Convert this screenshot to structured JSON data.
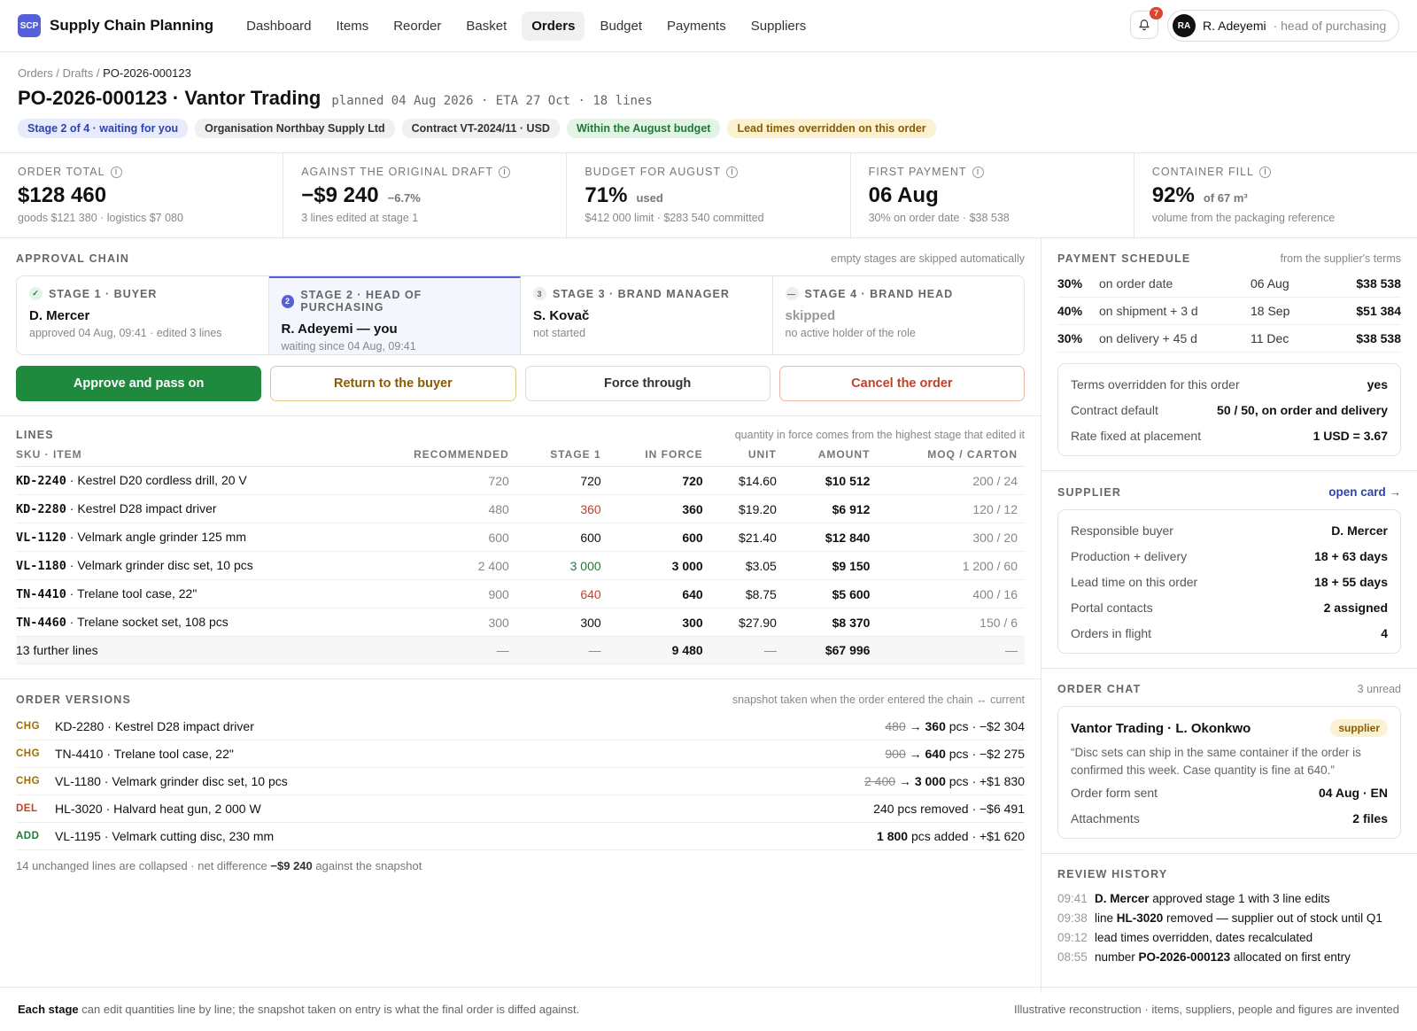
{
  "app": {
    "logo": "SCP",
    "name": "Supply Chain Planning"
  },
  "nav": [
    {
      "label": "Dashboard",
      "active": false
    },
    {
      "label": "Items",
      "active": false
    },
    {
      "label": "Reorder",
      "active": false
    },
    {
      "label": "Basket",
      "active": false
    },
    {
      "label": "Orders",
      "active": true
    },
    {
      "label": "Budget",
      "active": false
    },
    {
      "label": "Payments",
      "active": false
    },
    {
      "label": "Suppliers",
      "active": false
    }
  ],
  "notifications": {
    "icon": "bell-icon",
    "count": "7"
  },
  "user": {
    "initials": "RA",
    "name": "R. Adeyemi",
    "role": "· head of purchasing"
  },
  "breadcrumb": {
    "a": "Orders",
    "sep1": " / ",
    "b": "Drafts",
    "sep2": " / ",
    "c": "PO-2026-000123"
  },
  "order": {
    "title": "PO-2026-000123 · Vantor Trading",
    "meta": "planned 04 Aug 2026 · ETA 27 Oct · 18 lines"
  },
  "tags": [
    {
      "label": "Stage 2 of 4 · waiting for you",
      "tone": "blue"
    },
    {
      "label": "Organisation Northbay Supply Ltd",
      "tone": "grey"
    },
    {
      "label": "Contract VT-2024/11 · USD",
      "tone": "grey"
    },
    {
      "label": "Within the August budget",
      "tone": "green"
    },
    {
      "label": "Lead times overridden on this order",
      "tone": "amber"
    }
  ],
  "kpis": [
    {
      "label": "Order total",
      "value": "$128 460",
      "delta": "",
      "sub": "goods $121 380 · logistics $7 080"
    },
    {
      "label": "Against the original draft",
      "value": "−$9 240",
      "delta": "−6.7%",
      "sub": "3 lines edited at stage 1"
    },
    {
      "label": "Budget for August",
      "value": "71%",
      "delta": "used",
      "sub": "$412 000 limit · $283 540 committed"
    },
    {
      "label": "First payment",
      "value": "06 Aug",
      "delta": "",
      "sub": "30% on order date · $38 538"
    },
    {
      "label": "Container fill",
      "value": "92%",
      "delta": "of 67 m³",
      "sub": "volume from the packaging reference"
    }
  ],
  "approval": {
    "title": "Approval chain",
    "note": "empty stages are skipped automatically",
    "stages": [
      {
        "mark": "✓",
        "label": "STAGE 1 · BUYER",
        "name": "D. Mercer",
        "sub": "approved 04 Aug, 09:41 · edited 3 lines",
        "state": "done"
      },
      {
        "mark": "2",
        "label": "STAGE 2 · HEAD OF PURCHASING",
        "name": "R. Adeyemi — you",
        "sub": "waiting since 04 Aug, 09:41",
        "state": "cur"
      },
      {
        "mark": "3",
        "label": "STAGE 3 · BRAND MANAGER",
        "name": "S. Kovač",
        "sub": "not started",
        "state": "nxt"
      },
      {
        "mark": "—",
        "label": "STAGE 4 · BRAND HEAD",
        "name": "skipped",
        "sub": "no active holder of the role",
        "state": "skip"
      }
    ],
    "buttons": {
      "approve": "Approve and pass on",
      "return": "Return to the buyer",
      "force": "Force through",
      "cancel": "Cancel the order"
    }
  },
  "lines": {
    "title": "Lines",
    "note": "quantity in force comes from the highest stage that edited it",
    "columns": [
      "SKU · ITEM",
      "RECOMMENDED",
      "STAGE 1",
      "IN FORCE",
      "UNIT",
      "AMOUNT",
      "MOQ / CARTON"
    ],
    "rows": [
      {
        "sku": "KD-2240",
        "item": " · Kestrel D20 cordless drill, 20 V",
        "rec": "720",
        "s1": "720",
        "s1tone": "",
        "inforce": "720",
        "unit": "$14.60",
        "amount": "$10 512",
        "moq": "200 / 24"
      },
      {
        "sku": "KD-2280",
        "item": " · Kestrel D28 impact driver",
        "rec": "480",
        "s1": "360",
        "s1tone": "dn",
        "inforce": "360",
        "unit": "$19.20",
        "amount": "$6 912",
        "moq": "120 / 12"
      },
      {
        "sku": "VL-1120",
        "item": " · Velmark angle grinder 125 mm",
        "rec": "600",
        "s1": "600",
        "s1tone": "",
        "inforce": "600",
        "unit": "$21.40",
        "amount": "$12 840",
        "moq": "300 / 20"
      },
      {
        "sku": "VL-1180",
        "item": " · Velmark grinder disc set, 10 pcs",
        "rec": "2 400",
        "s1": "3 000",
        "s1tone": "up",
        "inforce": "3 000",
        "unit": "$3.05",
        "amount": "$9 150",
        "moq": "1 200 / 60"
      },
      {
        "sku": "TN-4410",
        "item": " · Trelane tool case, 22\"",
        "rec": "900",
        "s1": "640",
        "s1tone": "dn",
        "inforce": "640",
        "unit": "$8.75",
        "amount": "$5 600",
        "moq": "400 / 16"
      },
      {
        "sku": "TN-4460",
        "item": " · Trelane socket set, 108 pcs",
        "rec": "300",
        "s1": "300",
        "s1tone": "",
        "inforce": "300",
        "unit": "$27.90",
        "amount": "$8 370",
        "moq": "150 / 6"
      }
    ],
    "further": {
      "label": "13 further lines",
      "rec": "—",
      "s1": "—",
      "inforce": "9 480",
      "unit": "—",
      "amount": "$67 996",
      "moq": "—"
    }
  },
  "versions": {
    "title": "Order versions",
    "note": "snapshot taken when the order entered the chain ↔ current",
    "rows": [
      {
        "kind": "CHG",
        "tone": "chg",
        "item": "KD-2280 · Kestrel D28 impact driver",
        "old": "480",
        "arrow": " → ",
        "new": "360",
        "rest": " pcs · −$2 304"
      },
      {
        "kind": "CHG",
        "tone": "chg",
        "item": "TN-4410 · Trelane tool case, 22\"",
        "old": "900",
        "arrow": " → ",
        "new": "640",
        "rest": " pcs · −$2 275"
      },
      {
        "kind": "CHG",
        "tone": "chg",
        "item": "VL-1180 · Velmark grinder disc set, 10 pcs",
        "old": "2 400",
        "arrow": " → ",
        "new": "3 000",
        "rest": " pcs · +$1 830"
      },
      {
        "kind": "DEL",
        "tone": "del",
        "item": "HL-3020 · Halvard heat gun, 2 000 W",
        "old": "",
        "arrow": "",
        "new": "",
        "rest": "240 pcs removed · −$6 491"
      },
      {
        "kind": "ADD",
        "tone": "add",
        "item": "VL-1195 · Velmark cutting disc, 230 mm",
        "old": "",
        "arrow": "",
        "new": "1 800",
        "rest": " pcs added · +$1 620"
      }
    ],
    "foot_a": "14 unchanged lines are collapsed · net difference ",
    "foot_b": "−$9 240",
    "foot_c": " against the snapshot"
  },
  "payments": {
    "title": "Payment schedule",
    "note": "from the supplier's terms",
    "rows": [
      {
        "pct": "30%",
        "when": "on order date",
        "date": "06 Aug",
        "amount": "$38 538"
      },
      {
        "pct": "40%",
        "when": "on shipment + 3 d",
        "date": "18 Sep",
        "amount": "$51 384"
      },
      {
        "pct": "30%",
        "when": "on delivery + 45 d",
        "date": "11 Dec",
        "amount": "$38 538"
      }
    ],
    "terms": [
      {
        "l": "Terms overridden for this order",
        "v": "yes"
      },
      {
        "l": "Contract default",
        "v": "50 / 50, on order and delivery"
      },
      {
        "l": "Rate fixed at placement",
        "v": "1 USD = 3.67"
      }
    ]
  },
  "supplier": {
    "title": "Supplier",
    "link": "open card →",
    "rows": [
      {
        "l": "Responsible buyer",
        "v": "D. Mercer"
      },
      {
        "l": "Production + delivery",
        "v": "18 + 63 days"
      },
      {
        "l": "Lead time on this order",
        "v": "18 + 55 days"
      },
      {
        "l": "Portal contacts",
        "v": "2 assigned"
      },
      {
        "l": "Orders in flight",
        "v": "4"
      }
    ]
  },
  "chat": {
    "title": "Order chat",
    "note": "3 unread",
    "from": "Vantor Trading · L. Okonkwo",
    "badge": "supplier",
    "quote": "“Disc sets can ship in the same container if the order is confirmed this week. Case quantity is fine at 640.”",
    "rows": [
      {
        "l": "Order form sent",
        "v": "04 Aug · EN"
      },
      {
        "l": "Attachments",
        "v": "2 files"
      }
    ]
  },
  "history": {
    "title": "Review history",
    "rows": [
      {
        "time": "09:41",
        "pre": "",
        "bold": "D. Mercer",
        "post": " approved stage 1 with 3 line edits"
      },
      {
        "time": "09:38",
        "pre": "line ",
        "bold": "HL-3020",
        "post": " removed — supplier out of stock until Q1"
      },
      {
        "time": "09:12",
        "pre": "lead times overridden, dates recalculated",
        "bold": "",
        "post": ""
      },
      {
        "time": "08:55",
        "pre": "number ",
        "bold": "PO-2026-000123",
        "post": " allocated on first entry"
      }
    ]
  },
  "footer": {
    "bold": "Each stage",
    "text": " can edit quantities line by line; the snapshot taken on entry is what the final order is diffed against.",
    "right": "Illustrative reconstruction · items, suppliers, people and figures are invented"
  }
}
